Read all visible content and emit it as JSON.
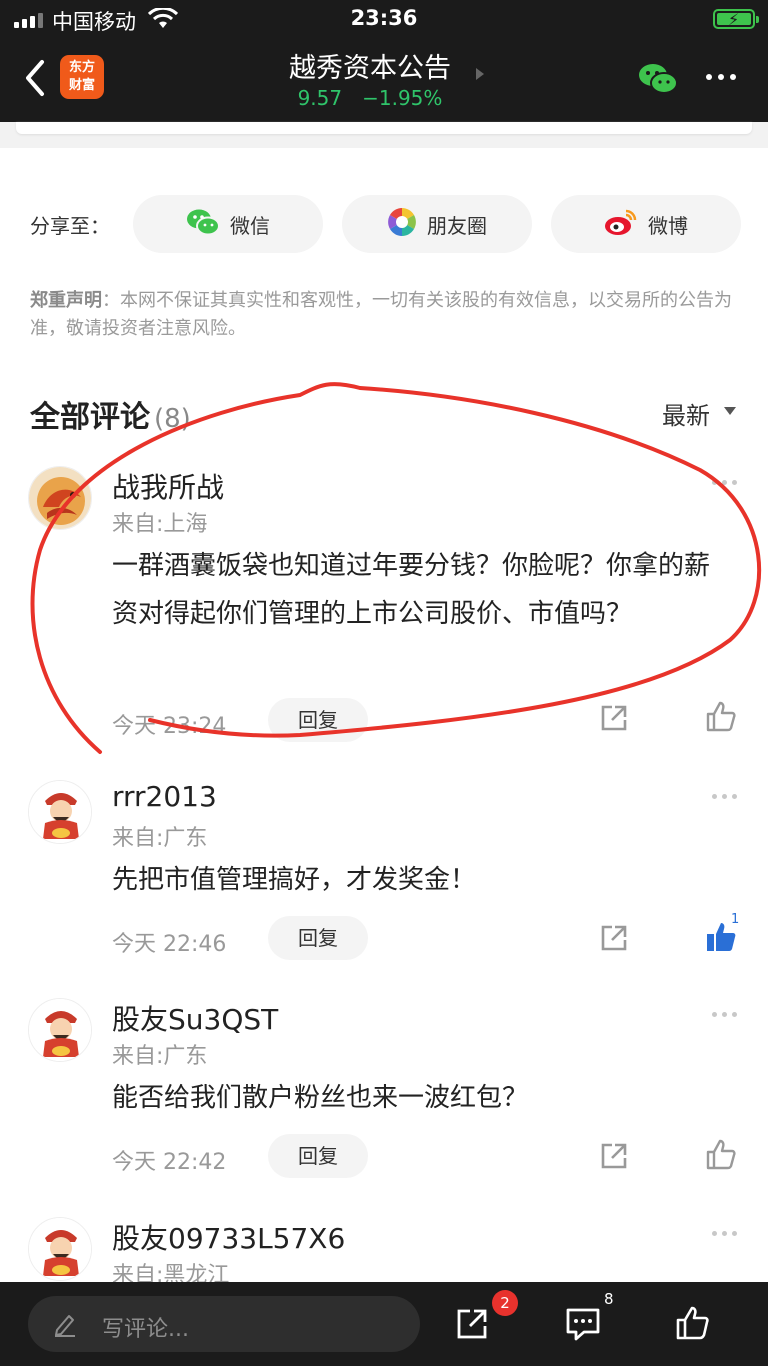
{
  "status_bar": {
    "carrier": "中国移动",
    "time": "23:36"
  },
  "nav": {
    "logo_line1": "东方",
    "logo_line2": "财富",
    "title": "越秀资本公告",
    "price": "9.57",
    "change": "−1.95%"
  },
  "share": {
    "label": "分享至：",
    "buttons": [
      {
        "label": "微信",
        "icon": "wechat-icon"
      },
      {
        "label": "朋友圈",
        "icon": "moments-icon"
      },
      {
        "label": "微博",
        "icon": "weibo-icon"
      }
    ]
  },
  "disclaimer": {
    "title": "郑重声明",
    "text": "：本网不保证其真实性和客观性，一切有关该股的有效信息，以交易所的公告为准，敬请投资者注意风险。"
  },
  "comments_header": {
    "title": "全部评论",
    "count": "(8)",
    "sort": "最新"
  },
  "comments": [
    {
      "name": "战我所战",
      "location": "来自:上海",
      "text": "一群酒囊饭袋也知道过年要分钱？你脸呢？你拿的薪资对得起你们管理的上市公司股价、市值吗？",
      "time": "今天 23:24",
      "reply": "回复",
      "likes": "",
      "liked": false
    },
    {
      "name": "rrr2013",
      "location": "来自:广东",
      "text": "先把市值管理搞好，才发奖金！",
      "time": "今天 22:46",
      "reply": "回复",
      "likes": "1",
      "liked": true
    },
    {
      "name": "股友Su3QST",
      "location": "来自:广东",
      "text": "能否给我们散户粉丝也来一波红包？",
      "time": "今天 22:42",
      "reply": "回复",
      "likes": "",
      "liked": false
    },
    {
      "name": "股友09733L57X6",
      "location": "来自:黑龙江"
    }
  ],
  "bottom_bar": {
    "placeholder": "写评论...",
    "share_badge": "2",
    "comment_count": "8"
  },
  "colors": {
    "bar_bg": "#1b1b1b",
    "price_green": "#2fc46a",
    "brand_orange": "#f05a1a",
    "like_blue": "#2a6fd6",
    "badge_red": "#e8322d",
    "annotation_red": "#e8332a"
  }
}
